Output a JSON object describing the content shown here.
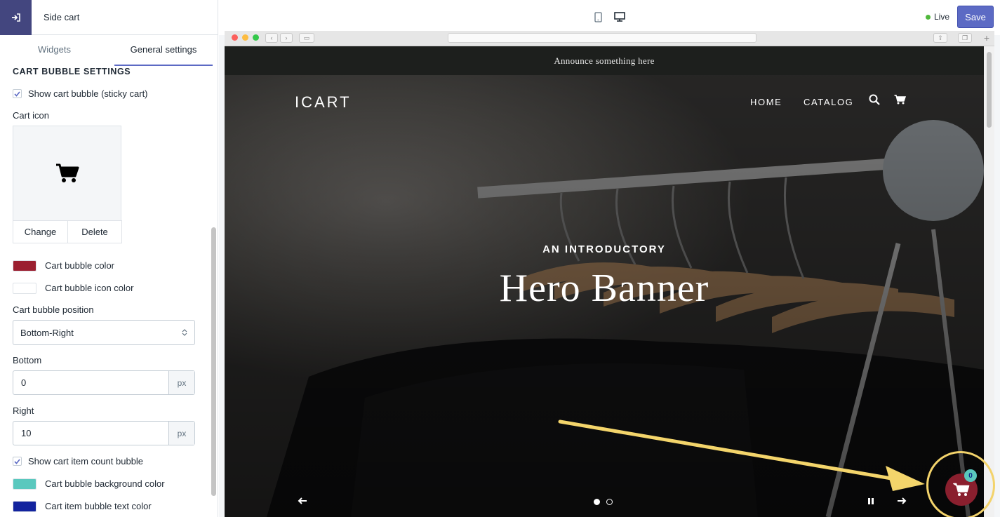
{
  "panel": {
    "title": "Side cart",
    "tabs": [
      "Widgets",
      "General settings"
    ],
    "active_tab": "General settings"
  },
  "settings": {
    "section_heading": "CART BUBBLE SETTINGS",
    "show_cart_bubble_label": "Show cart bubble (sticky cart)",
    "show_cart_bubble_checked": true,
    "cart_icon_label": "Cart icon",
    "change_label": "Change",
    "delete_label": "Delete",
    "cart_bubble_color_label": "Cart bubble color",
    "cart_bubble_color": "#9b1f30",
    "cart_bubble_icon_color_label": "Cart bubble icon color",
    "cart_bubble_icon_color": "#ffffff",
    "position_label": "Cart bubble position",
    "position_value": "Bottom-Right",
    "bottom_label": "Bottom",
    "bottom_value": "0",
    "right_label": "Right",
    "right_value": "10",
    "unit": "px",
    "show_count_label": "Show cart item count bubble",
    "show_count_checked": true,
    "count_bg_color_label": "Cart bubble background color",
    "count_bg_color": "#5ac8be",
    "count_text_color_label": "Cart item bubble text color",
    "count_text_color": "#12239e"
  },
  "topbar": {
    "status": "Live",
    "save_label": "Save",
    "active_device": "desktop"
  },
  "site": {
    "announcement": "Announce something here",
    "logo": "ICART",
    "nav": [
      "HOME",
      "CATALOG"
    ],
    "hero_subtitle": "AN INTRODUCTORY",
    "hero_title": "Hero Banner",
    "cart_count": "0",
    "slide_count": 2,
    "active_slide": 1
  },
  "icons": {
    "exit": "exit-icon",
    "mobile": "mobile-icon",
    "desktop": "desktop-icon",
    "search": "search-icon",
    "cart": "cart-icon",
    "prev": "arrow-left-icon",
    "next": "arrow-right-icon",
    "pause": "pause-icon"
  }
}
